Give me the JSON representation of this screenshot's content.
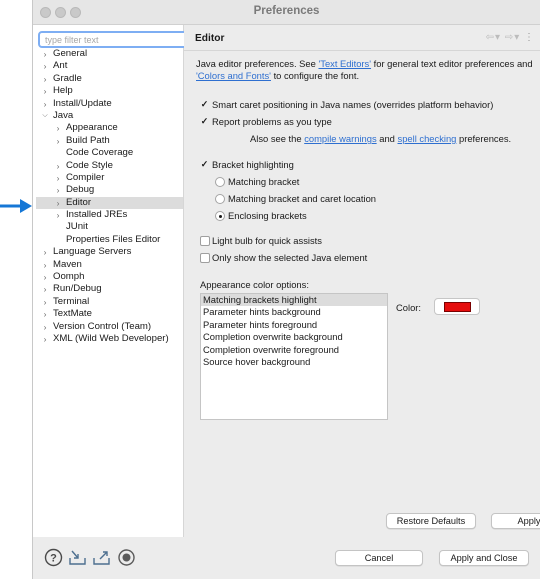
{
  "window": {
    "title": "Preferences"
  },
  "sidebar": {
    "filter_placeholder": "type filter text",
    "items": [
      {
        "label": "General",
        "twisty": "closed",
        "indent": 0
      },
      {
        "label": "Ant",
        "twisty": "closed",
        "indent": 0
      },
      {
        "label": "Gradle",
        "twisty": "closed",
        "indent": 0
      },
      {
        "label": "Help",
        "twisty": "closed",
        "indent": 0
      },
      {
        "label": "Install/Update",
        "twisty": "closed",
        "indent": 0
      },
      {
        "label": "Java",
        "twisty": "open",
        "indent": 0
      },
      {
        "label": "Appearance",
        "twisty": "closed",
        "indent": 1
      },
      {
        "label": "Build Path",
        "twisty": "closed",
        "indent": 1
      },
      {
        "label": "Code Coverage",
        "twisty": "none",
        "indent": 1
      },
      {
        "label": "Code Style",
        "twisty": "closed",
        "indent": 1
      },
      {
        "label": "Compiler",
        "twisty": "closed",
        "indent": 1
      },
      {
        "label": "Debug",
        "twisty": "closed",
        "indent": 1
      },
      {
        "label": "Editor",
        "twisty": "closed",
        "indent": 1,
        "selected": true
      },
      {
        "label": "Installed JREs",
        "twisty": "closed",
        "indent": 1
      },
      {
        "label": "JUnit",
        "twisty": "none",
        "indent": 1
      },
      {
        "label": "Properties Files Editor",
        "twisty": "none",
        "indent": 1
      },
      {
        "label": "Language Servers",
        "twisty": "closed",
        "indent": 0
      },
      {
        "label": "Maven",
        "twisty": "closed",
        "indent": 0
      },
      {
        "label": "Oomph",
        "twisty": "closed",
        "indent": 0
      },
      {
        "label": "Run/Debug",
        "twisty": "closed",
        "indent": 0
      },
      {
        "label": "Terminal",
        "twisty": "closed",
        "indent": 0
      },
      {
        "label": "TextMate",
        "twisty": "closed",
        "indent": 0
      },
      {
        "label": "Version Control (Team)",
        "twisty": "closed",
        "indent": 0
      },
      {
        "label": "XML (Wild Web Developer)",
        "twisty": "closed",
        "indent": 0
      }
    ]
  },
  "page": {
    "title": "Editor",
    "desc_part1": "Java editor preferences. See ",
    "link_text_editors": "'Text Editors'",
    "desc_part2": " for general text editor preferences and ",
    "link_colors_fonts": "'Colors and Fonts'",
    "desc_part3": " to configure the font.",
    "options": {
      "smart_caret": {
        "label": "Smart caret positioning in Java names (overrides platform behavior)",
        "checked": true
      },
      "report_problems": {
        "label": "Report problems as you type",
        "checked": true
      },
      "see_also_prefix": "Also see the ",
      "compile_warnings_link": "compile warnings",
      "see_also_and": " and ",
      "spell_checking_link": "spell checking",
      "see_also_suffix": " preferences.",
      "bracket_highlighting": {
        "label": "Bracket highlighting",
        "checked": true
      },
      "radio_matching": {
        "label": "Matching bracket",
        "selected": false
      },
      "radio_matching_caret": {
        "label": "Matching bracket and caret location",
        "selected": false
      },
      "radio_enclosing": {
        "label": "Enclosing brackets",
        "selected": true
      },
      "light_bulb": {
        "label": "Light bulb for quick assists",
        "checked": false
      },
      "only_selected": {
        "label": "Only show the selected Java element",
        "checked": false
      }
    },
    "appearance": {
      "heading": "Appearance color options:",
      "items": [
        "Matching brackets highlight",
        "Parameter hints background",
        "Parameter hints foreground",
        "Completion overwrite background",
        "Completion overwrite foreground",
        "Source hover background"
      ],
      "selected_index": 0,
      "color_label": "Color:",
      "color_value": "#e50d0d"
    },
    "restore_defaults": "Restore Defaults",
    "apply": "Apply"
  },
  "footer": {
    "cancel": "Cancel",
    "apply_and_close": "Apply and Close",
    "icons": [
      "help-icon",
      "import-icon",
      "export-icon",
      "record-icon"
    ]
  },
  "colors": {
    "accent": "#2e6fd0",
    "arrow": "#1577d6",
    "selection": "#dcdcdc"
  }
}
